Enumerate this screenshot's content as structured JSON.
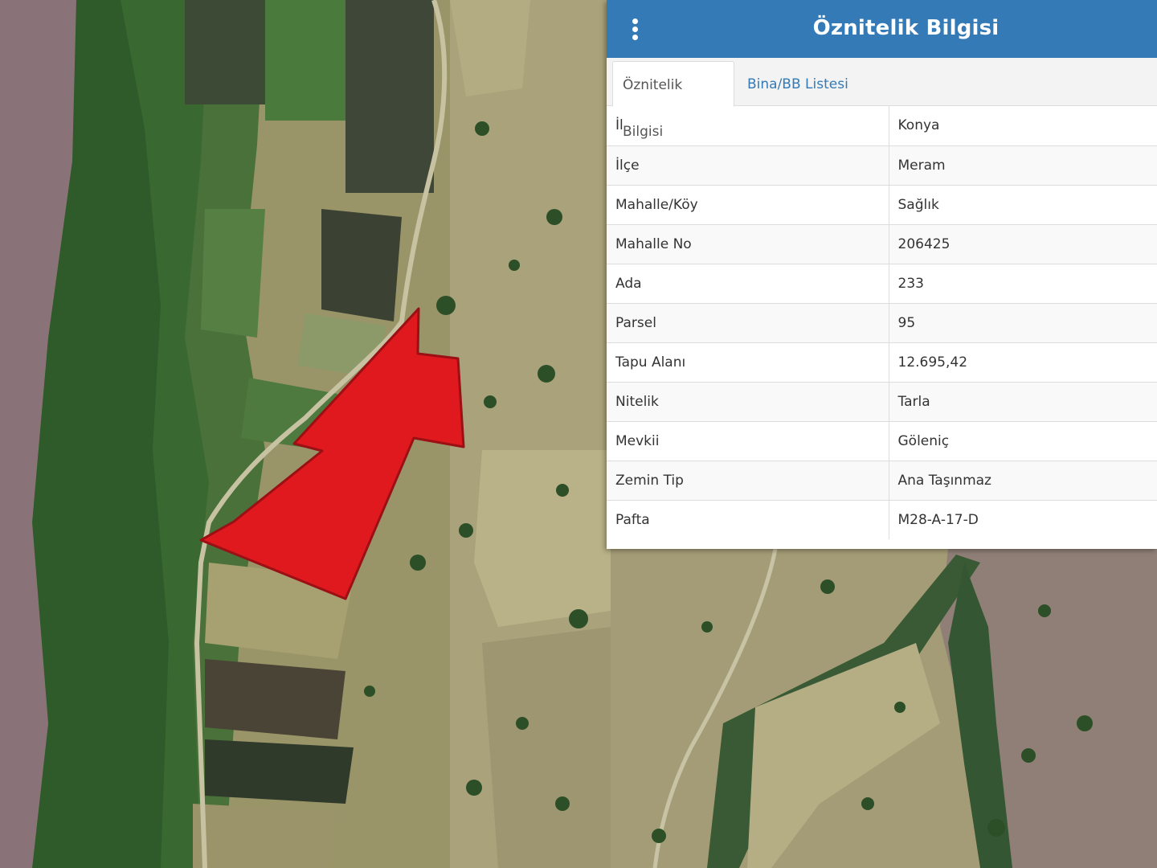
{
  "panel": {
    "title": "Öznitelik Bilgisi",
    "menu_icon": "kebab-menu-icon",
    "header_color": "#337ab7",
    "tabs": [
      {
        "label": "Öznitelik Bilgisi",
        "active": true
      },
      {
        "label": "Bina/BB Listesi",
        "active": false
      }
    ],
    "rows": [
      {
        "key": "İl",
        "value": "Konya"
      },
      {
        "key": "İlçe",
        "value": "Meram"
      },
      {
        "key": "Mahalle/Köy",
        "value": "Sağlık"
      },
      {
        "key": "Mahalle No",
        "value": "206425"
      },
      {
        "key": "Ada",
        "value": "233"
      },
      {
        "key": "Parsel",
        "value": "95"
      },
      {
        "key": "Tapu Alanı",
        "value": "12.695,42"
      },
      {
        "key": "Nitelik",
        "value": "Tarla"
      },
      {
        "key": "Mevkii",
        "value": "Göleniç"
      },
      {
        "key": "Zemin Tip",
        "value": "Ana Taşınmaz"
      },
      {
        "key": "Pafta",
        "value": "M28-A-17-D"
      }
    ]
  },
  "map": {
    "type": "satellite",
    "parcel_fill": "#e0191e",
    "parcel_outline": "#9a1015"
  }
}
